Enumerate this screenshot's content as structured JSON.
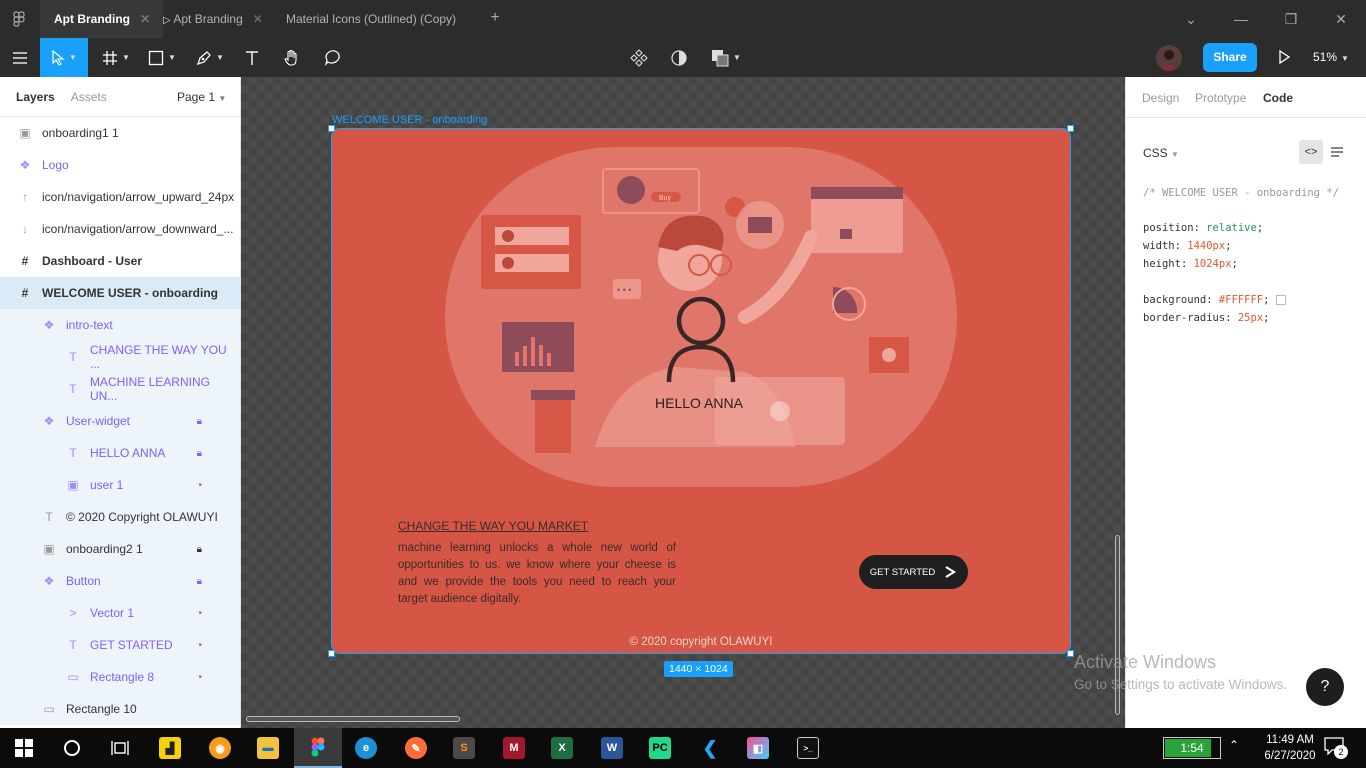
{
  "titlebar": {
    "tabs": [
      {
        "label": "Apt Branding"
      },
      {
        "label": "Apt Branding"
      },
      {
        "label": "Material Icons (Outlined) (Copy)"
      }
    ]
  },
  "toolbar": {
    "share_label": "Share",
    "zoom": "51%"
  },
  "left_panel": {
    "tabs": {
      "layers": "Layers",
      "assets": "Assets"
    },
    "page": "Page 1",
    "layers": [
      {
        "label": "onboarding1 1"
      },
      {
        "label": "Logo"
      },
      {
        "label": "icon/navigation/arrow_upward_24px"
      },
      {
        "label": "icon/navigation/arrow_downward_..."
      },
      {
        "label": "Dashboard - User"
      },
      {
        "label": "WELCOME USER - onboarding"
      },
      {
        "label": "intro-text"
      },
      {
        "label": "CHANGE THE WAY YOU ..."
      },
      {
        "label": "MACHINE LEARNING UN..."
      },
      {
        "label": "User-widget"
      },
      {
        "label": "HELLO ANNA"
      },
      {
        "label": "user 1"
      },
      {
        "label": "© 2020 Copyright OLAWUYI"
      },
      {
        "label": "onboarding2 1"
      },
      {
        "label": "Button"
      },
      {
        "label": "Vector 1"
      },
      {
        "label": "GET STARTED"
      },
      {
        "label": "Rectangle 8"
      },
      {
        "label": "Rectangle 10"
      }
    ]
  },
  "canvas": {
    "frame_label": "WELCOME USER - onboarding",
    "frame_size": "1440 × 1024",
    "greeting": "HELLO ANNA",
    "intro_title": "CHANGE THE WAY YOU MARKET",
    "intro_body": "machine learning unlocks a whole new world of opportunities to us. we know where your cheese is and we provide the tools you need to reach your target audience digitally.",
    "button_label": "GET STARTED",
    "copyright": "© 2020 copyright OLAWUYI",
    "illustration_buy": "Buy",
    "illustration_dots": "• • •",
    "colors": {
      "frame": "#d65645",
      "blob": "#e0766a",
      "accent": "#18a0fb"
    }
  },
  "right_panel": {
    "tabs": {
      "design": "Design",
      "prototype": "Prototype",
      "code": "Code"
    },
    "language": "CSS",
    "code_comment": "/* WELCOME USER - onboarding */",
    "props": [
      {
        "key": "position",
        "value": "relative"
      },
      {
        "key": "width",
        "value": "1440px"
      },
      {
        "key": "height",
        "value": "1024px"
      },
      {
        "key": "background",
        "value": "#FFFFFF"
      },
      {
        "key": "border-radius",
        "value": "25px"
      }
    ]
  },
  "watermark": {
    "title": "Activate Windows",
    "subtitle": "Go to Settings to activate Windows."
  },
  "help_label": "?",
  "taskbar": {
    "battery": "1:54",
    "time": "11:49 AM",
    "date": "6/27/2020",
    "notifications": "2"
  }
}
